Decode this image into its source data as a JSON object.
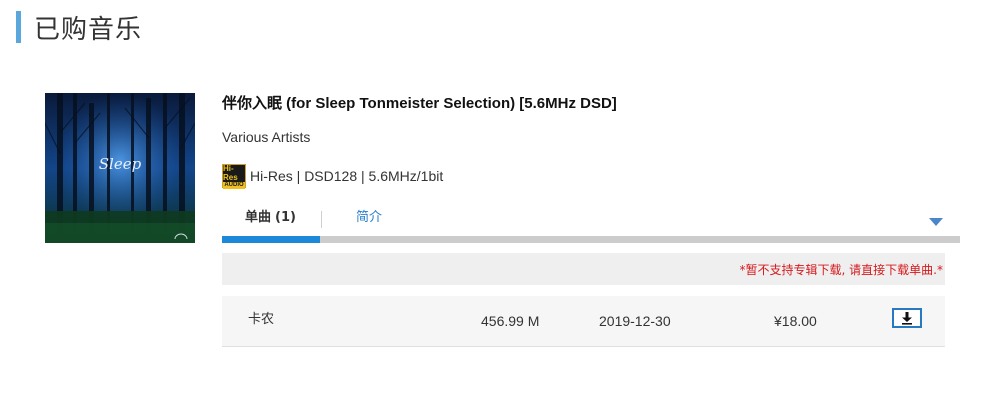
{
  "page": {
    "title": "已购音乐"
  },
  "album": {
    "title": "伴你入眠 (for Sleep Tonmeister Selection) [5.6MHz DSD]",
    "artist": "Various Artists",
    "cover_text": "Sleep",
    "badge": {
      "line1": "Hi-Res",
      "line2": "AUDIO"
    },
    "format": "Hi-Res | DSD128 | 5.6MHz/1bit"
  },
  "tabs": {
    "items": [
      {
        "label": "单曲",
        "count": "(1)",
        "active": true
      },
      {
        "label": "简介",
        "active": false
      }
    ]
  },
  "notice": "*暂不支持专辑下载, 请直接下载单曲.*",
  "tracks": [
    {
      "name": "卡农",
      "size": "456.99 M",
      "date": "2019-12-30",
      "price": "¥18.00"
    }
  ],
  "colors": {
    "accent": "#5aa7dd",
    "tab_active": "#1e88d8",
    "link": "#2a7fc9",
    "notice": "#d7191c",
    "download_border": "#2779c2"
  },
  "icons": {
    "download": "download-icon",
    "dropdown": "triangle-down-icon"
  }
}
